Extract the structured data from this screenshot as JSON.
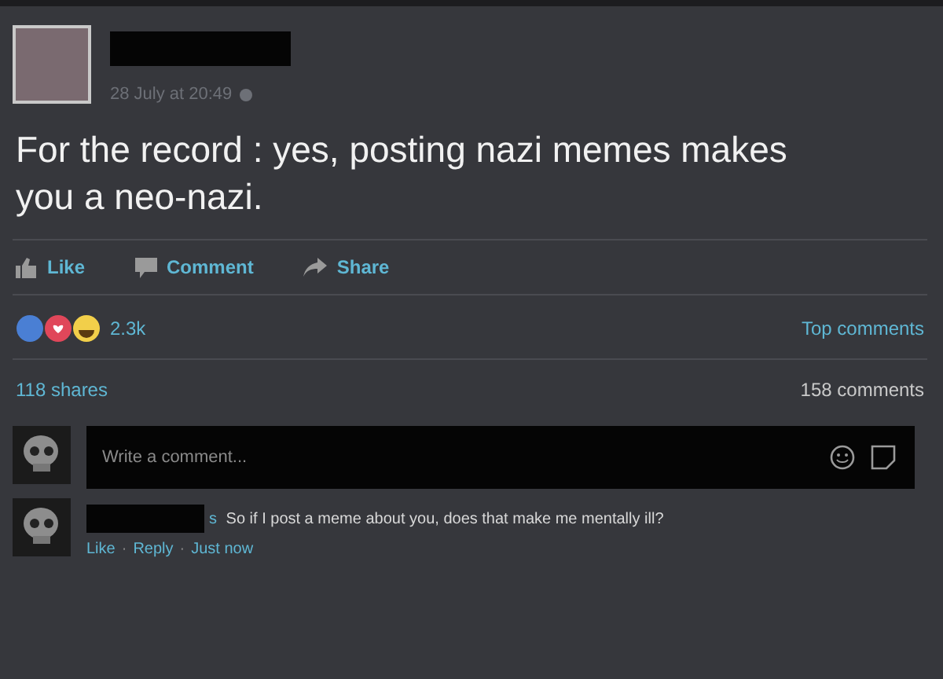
{
  "post": {
    "timestamp": "28 July at 20:49",
    "text": "For the record : yes, posting nazi memes makes you a neo-nazi.",
    "actions": [
      {
        "kind": "like",
        "label": "Like"
      },
      {
        "kind": "comment",
        "label": "Comment"
      },
      {
        "kind": "share",
        "label": "Share"
      }
    ],
    "reaction_count": "2.3k",
    "sort": "Top comments",
    "shares": "118 shares",
    "comments": "158 comments"
  },
  "comment_box": {
    "placeholder": "Write a comment..."
  },
  "comments": [
    {
      "name_tail": "s",
      "text": "So if I post a meme about you, does that make me mentally ill?",
      "actions": [
        "Like",
        "Reply"
      ],
      "separator": "·",
      "time": "Just now"
    }
  ]
}
